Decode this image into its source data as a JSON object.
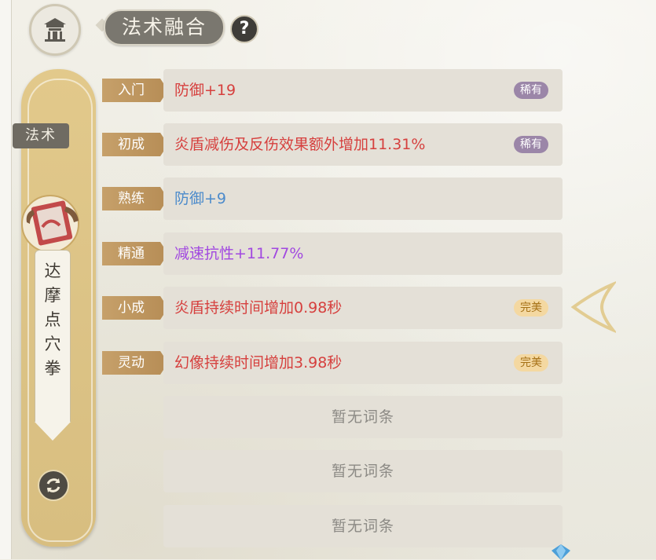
{
  "header": {
    "title": "法术融合",
    "help_label": "?"
  },
  "sidebar": {
    "category_tab": "法术",
    "skill_name": "达摩点穴拳"
  },
  "rows": [
    {
      "stage": "入门",
      "text": "防御+19",
      "badge": "稀有",
      "color": "red"
    },
    {
      "stage": "初成",
      "text": "炎盾减伤及反伤效果额外增加11.31%",
      "badge": "稀有",
      "color": "red"
    },
    {
      "stage": "熟练",
      "text": "防御+9",
      "badge": "",
      "color": "blue"
    },
    {
      "stage": "精通",
      "text": "减速抗性+11.77%",
      "badge": "",
      "color": "purple"
    },
    {
      "stage": "小成",
      "text": "炎盾持续时间增加0.98秒",
      "badge": "完美",
      "color": "red"
    },
    {
      "stage": "灵动",
      "text": "幻像持续时间增加3.98秒",
      "badge": "完美",
      "color": "red"
    }
  ],
  "empty_rows": [
    "暂无词条",
    "暂无词条",
    "暂无词条"
  ],
  "colors": {
    "red_text": "#d6403e",
    "blue_text": "#4c8bcb",
    "purple_text": "#a148e0",
    "rare_badge": "#9b86a8",
    "perfect_badge": "#f4d8a1",
    "tag_gold": "#c6a06a"
  },
  "icons": {
    "home": "pavilion-icon",
    "switch": "switch-icon",
    "collapse_arrow": "chevron-left-icon",
    "currency": "gem-icon"
  }
}
